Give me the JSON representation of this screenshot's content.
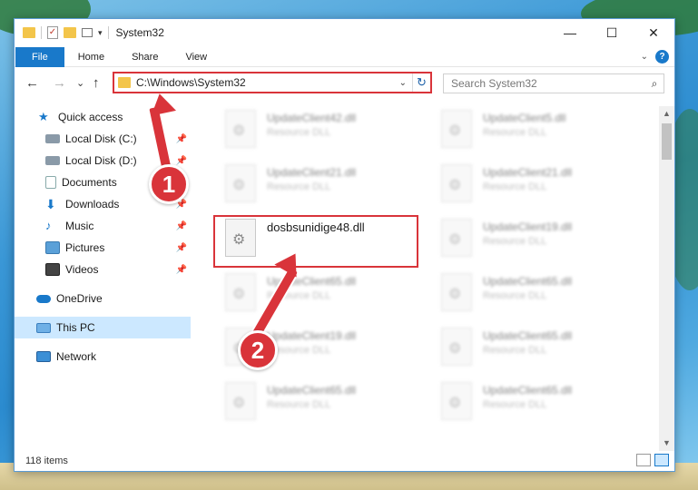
{
  "window": {
    "title": "System32",
    "buttons": {
      "minimize": "—",
      "maximize": "☐",
      "close": "✕"
    }
  },
  "ribbon": {
    "tabs": [
      "File",
      "Home",
      "Share",
      "View"
    ]
  },
  "nav": {
    "back": "←",
    "forward": "→",
    "recent": "⌄",
    "up": "↑",
    "address": "C:\\Windows\\System32",
    "search_placeholder": "Search System32"
  },
  "sidebar": {
    "items": [
      {
        "label": "Quick access",
        "icon": "star-icon",
        "pinned": false
      },
      {
        "label": "Local Disk (C:)",
        "icon": "drive-icon",
        "pinned": true
      },
      {
        "label": "Local Disk (D:)",
        "icon": "drive-icon",
        "pinned": true
      },
      {
        "label": "Documents",
        "icon": "documents-icon",
        "pinned": true
      },
      {
        "label": "Downloads",
        "icon": "downloads-icon",
        "pinned": true
      },
      {
        "label": "Music",
        "icon": "music-icon",
        "pinned": true
      },
      {
        "label": "Pictures",
        "icon": "pictures-icon",
        "pinned": true
      },
      {
        "label": "Videos",
        "icon": "videos-icon",
        "pinned": true
      },
      {
        "label": "OneDrive",
        "icon": "onedrive-icon",
        "pinned": false
      },
      {
        "label": "This PC",
        "icon": "computer-icon",
        "pinned": false,
        "selected": true
      },
      {
        "label": "Network",
        "icon": "network-icon",
        "pinned": false
      }
    ]
  },
  "files": {
    "highlighted": {
      "name": "dosbsunidige48.dll"
    },
    "blurred": [
      {
        "name": "UpdateClient42.dll",
        "type": "Resource DLL"
      },
      {
        "name": "UpdateClient5.dll",
        "type": "Resource DLL"
      },
      {
        "name": "UpdateClient21.dll",
        "type": "Resource DLL"
      },
      {
        "name": "UpdateClient21.dll",
        "type": "Resource DLL"
      },
      {
        "name": "UpdateClient19.dll",
        "type": "Resource DLL"
      },
      {
        "name": "UpdateClient65.dll",
        "type": "Resource DLL"
      },
      {
        "name": "UpdateClient65.dll",
        "type": "Resource DLL"
      },
      {
        "name": "UpdateClient19.dll",
        "type": "Resource DLL"
      },
      {
        "name": "UpdateClient65.dll",
        "type": "Resource DLL"
      },
      {
        "name": "UpdateClient65.dll",
        "type": "Resource DLL"
      },
      {
        "name": "UpdateClient65.dll",
        "type": "Resource DLL"
      }
    ]
  },
  "status": {
    "item_count": "118 items"
  },
  "annotations": {
    "step1": "1",
    "step2": "2"
  },
  "colors": {
    "accent": "#1979ca",
    "highlight": "#d9343a",
    "selected": "#cce8ff"
  }
}
